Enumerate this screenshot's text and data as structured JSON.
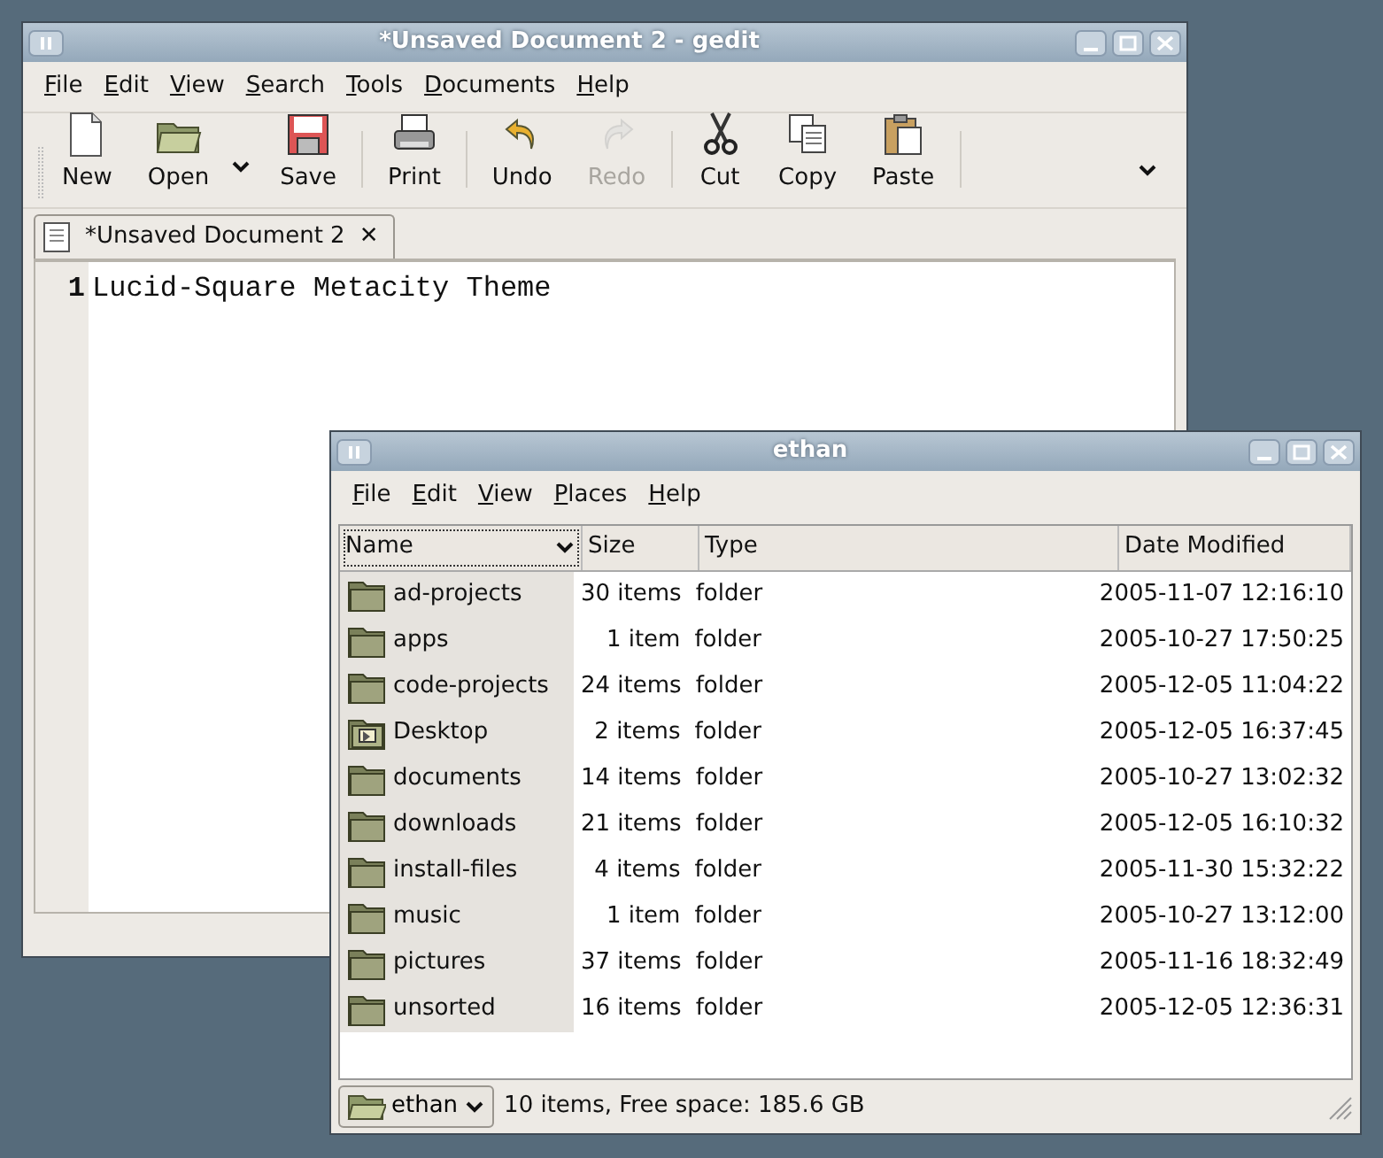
{
  "editor_window": {
    "title": "*Unsaved Document 2 - gedit",
    "menu": [
      "File",
      "Edit",
      "View",
      "Search",
      "Tools",
      "Documents",
      "Help"
    ],
    "toolbar": [
      {
        "kind": "button",
        "label": "New",
        "disabled": false
      },
      {
        "kind": "button",
        "label": "Open",
        "disabled": false
      },
      {
        "kind": "arrow"
      },
      {
        "kind": "button",
        "label": "Save",
        "disabled": false
      },
      {
        "kind": "separator"
      },
      {
        "kind": "button",
        "label": "Print",
        "disabled": false
      },
      {
        "kind": "separator"
      },
      {
        "kind": "button",
        "label": "Undo",
        "disabled": false
      },
      {
        "kind": "button",
        "label": "Redo",
        "disabled": true
      },
      {
        "kind": "separator"
      },
      {
        "kind": "button",
        "label": "Cut",
        "disabled": false
      },
      {
        "kind": "button",
        "label": "Copy",
        "disabled": false
      },
      {
        "kind": "button",
        "label": "Paste",
        "disabled": false
      },
      {
        "kind": "separator"
      },
      {
        "kind": "arrow"
      }
    ],
    "tabs": [
      {
        "label": "*Unsaved Document 2",
        "close": "✕",
        "selected": true
      }
    ],
    "lines": [
      {
        "number": "1",
        "text": "Lucid-Square Metacity Theme"
      }
    ]
  },
  "file_window": {
    "title": "ethan",
    "menu": [
      "File",
      "Edit",
      "View",
      "Places",
      "Help"
    ],
    "columns": [
      {
        "label": "Name",
        "sorted": true
      },
      {
        "label": "Size",
        "sorted": false
      },
      {
        "label": "Type",
        "sorted": false
      },
      {
        "label": "Date Modified",
        "sorted": false
      }
    ],
    "rows": [
      {
        "kind": "folder",
        "name": "ad-projects",
        "size": "30 items",
        "type": "folder",
        "date": "2005-11-07 12:16:10"
      },
      {
        "kind": "folder",
        "name": "apps",
        "size": "1 item",
        "type": "folder",
        "date": "2005-10-27 17:50:25"
      },
      {
        "kind": "folder",
        "name": "code-projects",
        "size": "24 items",
        "type": "folder",
        "date": "2005-12-05 11:04:22"
      },
      {
        "kind": "desktop",
        "name": "Desktop",
        "size": "2 items",
        "type": "folder",
        "date": "2005-12-05 16:37:45"
      },
      {
        "kind": "folder",
        "name": "documents",
        "size": "14 items",
        "type": "folder",
        "date": "2005-10-27 13:02:32"
      },
      {
        "kind": "folder",
        "name": "downloads",
        "size": "21 items",
        "type": "folder",
        "date": "2005-12-05 16:10:32"
      },
      {
        "kind": "folder",
        "name": "install-files",
        "size": "4 items",
        "type": "folder",
        "date": "2005-11-30 15:32:22"
      },
      {
        "kind": "folder",
        "name": "music",
        "size": "1 item",
        "type": "folder",
        "date": "2005-10-27 13:12:00"
      },
      {
        "kind": "folder",
        "name": "pictures",
        "size": "37 items",
        "type": "folder",
        "date": "2005-11-16 18:32:49"
      },
      {
        "kind": "folder",
        "name": "unsorted",
        "size": "16 items",
        "type": "folder",
        "date": "2005-12-05 12:36:31"
      }
    ],
    "location_button": "ethan",
    "status": "10 items, Free space: 185.6 GB"
  }
}
